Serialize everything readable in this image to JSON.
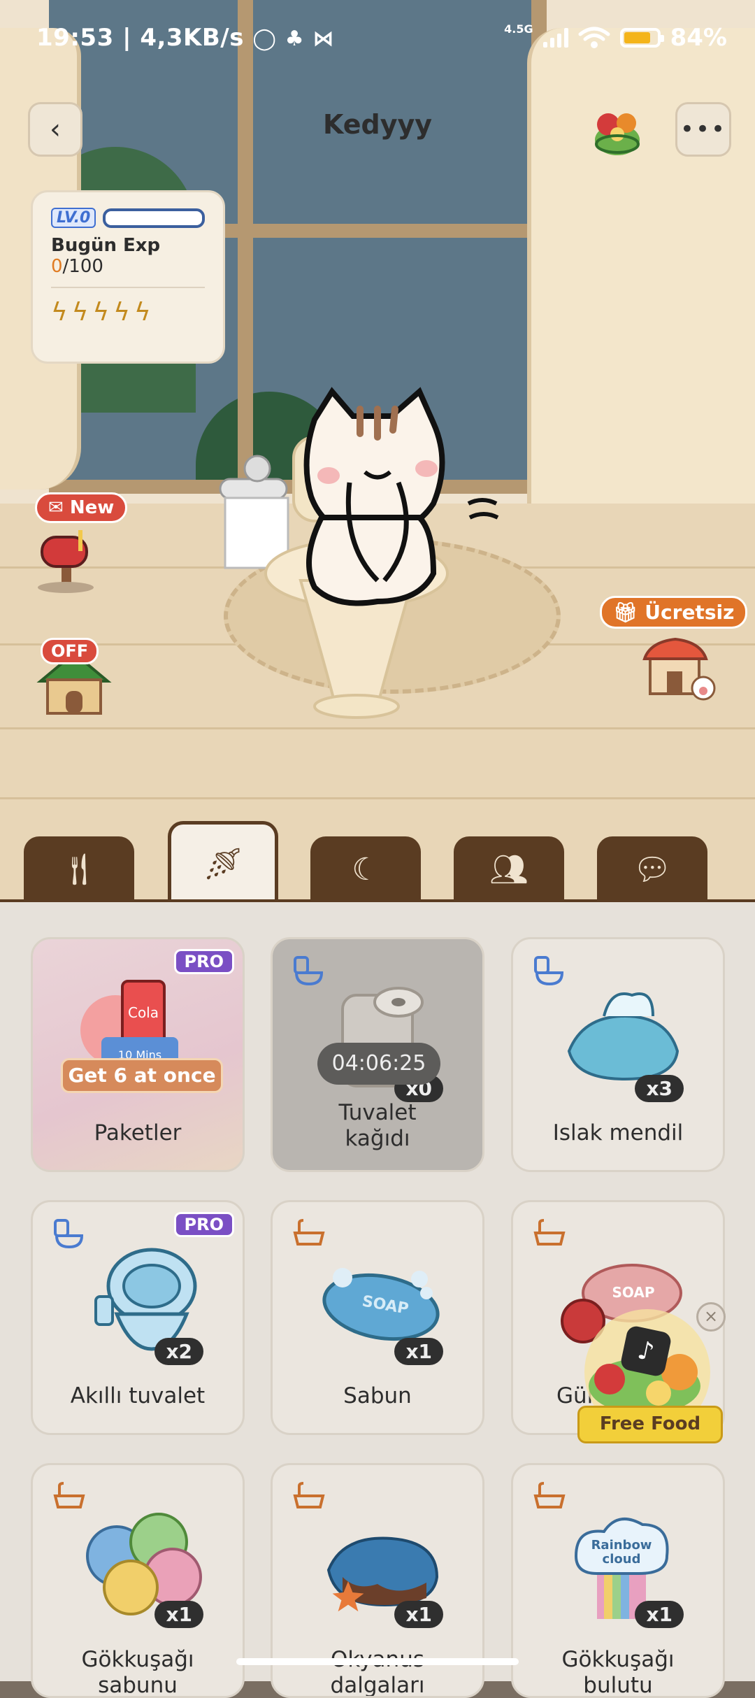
{
  "status_bar": {
    "left_text": "19:53 | 4,3KB/s",
    "network_label": "4.5G",
    "battery_percent": "84%",
    "battery_level": 0.84
  },
  "header": {
    "title": "Kedyyy",
    "back_icon": "chevron-left-icon",
    "more_icon": "ellipsis-icon"
  },
  "exp": {
    "level_badge": "LV.0",
    "label": "Bugün Exp",
    "current": "0",
    "max": "/100",
    "energy_icons": 5
  },
  "badges": {
    "new": "New",
    "off": "OFF",
    "free": "Ücretsiz"
  },
  "tabs": [
    {
      "name": "food",
      "icon": "fork-knife-icon"
    },
    {
      "name": "bath",
      "icon": "shower-icon"
    },
    {
      "name": "sleep",
      "icon": "moon-cup-icon"
    },
    {
      "name": "social",
      "icon": "group-icon"
    },
    {
      "name": "chat",
      "icon": "speech-bubble-icon"
    }
  ],
  "items": [
    {
      "label": "Paketler",
      "pro": "PRO",
      "promo": "Get 6 at once",
      "count": ""
    },
    {
      "label": "Tuvalet\nkağıdı",
      "timer": "04:06:25",
      "count": "x0"
    },
    {
      "label": "Islak mendil",
      "count": "x3"
    },
    {
      "label": "Akıllı tuvalet",
      "pro": "PRO",
      "count": "x2"
    },
    {
      "label": "Sabun",
      "count": "x1"
    },
    {
      "label": "Gül",
      "count": ""
    },
    {
      "label": "Gökkuşağı\nsabunu",
      "count": "x1"
    },
    {
      "label": "Okyanus\ndalgaları",
      "count": "x1"
    },
    {
      "label": "Gökkuşağı\nbulutu",
      "count": "x1"
    }
  ],
  "art_text": {
    "cola": "Cola",
    "mins": "10 Mins",
    "soap": "SOAP",
    "rainbow": "Rainbow\ncloud"
  },
  "free_food": {
    "label": "Free Food",
    "close": "×"
  },
  "colors": {
    "tab_brown": "#5a3c22",
    "pro_purple": "#7a4fc4",
    "badge_red": "#d94b3d"
  }
}
